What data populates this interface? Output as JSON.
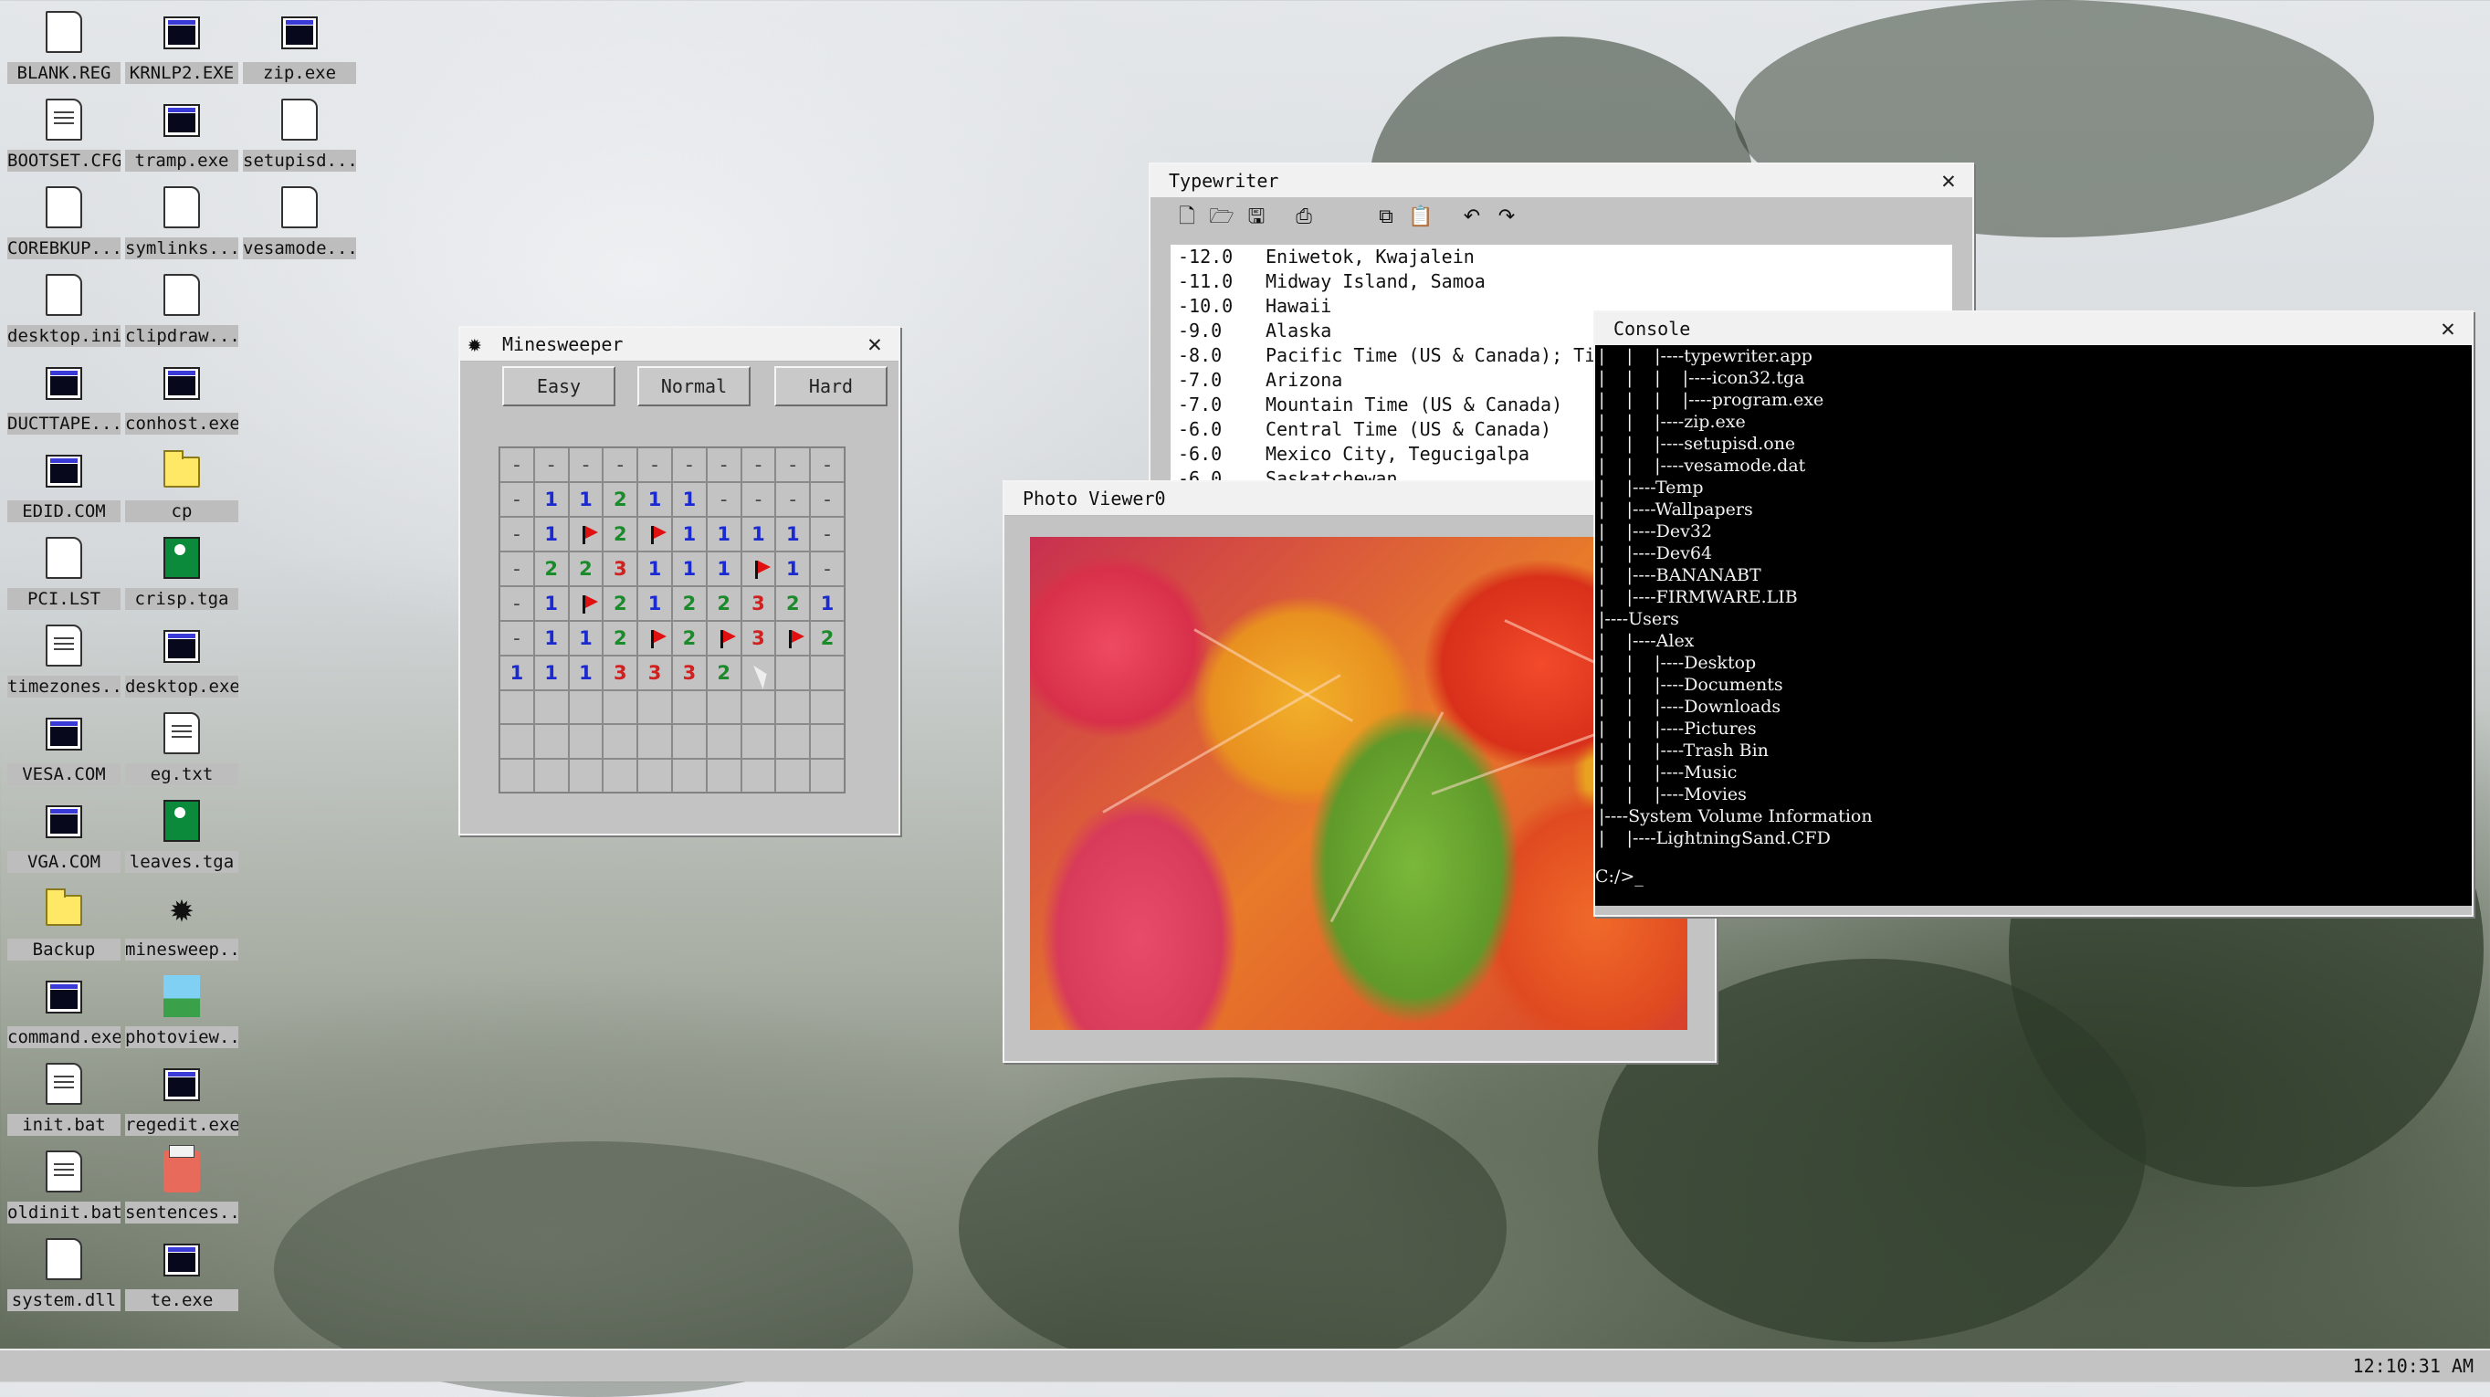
{
  "desktop": {
    "icons": [
      {
        "label": "BLANK.REG",
        "icon": "document-icon"
      },
      {
        "label": "KRNLP2.EXE",
        "icon": "program-icon"
      },
      {
        "label": "zip.exe",
        "icon": "program-icon"
      },
      {
        "label": "BOOTSET.CFG",
        "icon": "config-icon"
      },
      {
        "label": "tramp.exe",
        "icon": "program-icon"
      },
      {
        "label": "setupisd...",
        "icon": "document-icon"
      },
      {
        "label": "COREBKUP...",
        "icon": "document-icon"
      },
      {
        "label": "symlinks...",
        "icon": "document-icon"
      },
      {
        "label": "vesamode...",
        "icon": "document-icon"
      },
      {
        "label": "desktop.ini",
        "icon": "document-icon"
      },
      {
        "label": "clipdraw...",
        "icon": "document-icon"
      },
      {
        "label": "DUCTTAPE...",
        "icon": "program-icon"
      },
      {
        "label": "conhost.exe",
        "icon": "program-icon"
      },
      {
        "label": "EDID.COM",
        "icon": "program-icon"
      },
      {
        "label": "cp",
        "icon": "folder-icon"
      },
      {
        "label": "PCI.LST",
        "icon": "document-icon"
      },
      {
        "label": "crisp.tga",
        "icon": "image-icon"
      },
      {
        "label": "timezones...",
        "icon": "text-file-icon"
      },
      {
        "label": "desktop.exe",
        "icon": "program-icon"
      },
      {
        "label": "VESA.COM",
        "icon": "program-icon"
      },
      {
        "label": "eg.txt",
        "icon": "text-file-icon"
      },
      {
        "label": "VGA.COM",
        "icon": "program-icon"
      },
      {
        "label": "leaves.tga",
        "icon": "image-icon"
      },
      {
        "label": "Backup",
        "icon": "folder-icon"
      },
      {
        "label": "minesweep...",
        "icon": "mine-icon"
      },
      {
        "label": "command.exe",
        "icon": "program-icon"
      },
      {
        "label": "photoview...",
        "icon": "photo-viewer-icon"
      },
      {
        "label": "init.bat",
        "icon": "batch-file-icon"
      },
      {
        "label": "regedit.exe",
        "icon": "program-icon"
      },
      {
        "label": "oldinit.bat",
        "icon": "batch-file-icon"
      },
      {
        "label": "sentences...",
        "icon": "typewriter-icon"
      },
      {
        "label": "system.dll",
        "icon": "document-icon"
      },
      {
        "label": "te.exe",
        "icon": "program-icon"
      }
    ]
  },
  "minesweeper": {
    "title": "Minesweeper",
    "buttons": {
      "easy": "Easy",
      "normal": "Normal",
      "hard": "Hard"
    },
    "grid": [
      [
        "-",
        "-",
        "-",
        "-",
        "-",
        "-",
        "-",
        "-",
        "-",
        "-"
      ],
      [
        "-",
        "1",
        "1",
        "2",
        "1",
        "1",
        "-",
        "-",
        "-",
        "-"
      ],
      [
        "-",
        "1",
        "F",
        "2",
        "F",
        "1",
        "1",
        "1",
        "1",
        "-"
      ],
      [
        "-",
        "2",
        "2",
        "3",
        "1",
        "1",
        "1",
        "F",
        "1",
        "-"
      ],
      [
        "-",
        "1",
        "F",
        "2",
        "1",
        "2",
        "2",
        "3",
        "2",
        "1"
      ],
      [
        "-",
        "1",
        "1",
        "2",
        "F",
        "2",
        "F",
        "3",
        "F",
        "2"
      ],
      [
        "1",
        "1",
        "1",
        "3",
        "3",
        "3",
        "2",
        "",
        "",
        ""
      ],
      [
        "",
        "",
        "",
        "",
        "",
        "",
        "",
        "",
        "",
        ""
      ],
      [
        "",
        "",
        "",
        "",
        "",
        "",
        "",
        "",
        "",
        ""
      ],
      [
        "",
        "",
        "",
        "",
        "",
        "",
        "",
        "",
        "",
        ""
      ]
    ]
  },
  "typewriter": {
    "title": "Typewriter",
    "toolbar": [
      "new-file-icon",
      "open-folder-icon",
      "save-icon",
      "print-icon",
      "copy-icon",
      "paste-icon",
      "undo-icon",
      "redo-icon"
    ],
    "lines": [
      {
        "offset": "-12.0",
        "zone": "Eniwetok, Kwajalein"
      },
      {
        "offset": "-11.0",
        "zone": "Midway Island, Samoa"
      },
      {
        "offset": "-10.0",
        "zone": "Hawaii"
      },
      {
        "offset": "-9.0",
        "zone": "Alaska"
      },
      {
        "offset": "-8.0",
        "zone": "Pacific Time (US & Canada); Tiju"
      },
      {
        "offset": "-7.0",
        "zone": "Arizona"
      },
      {
        "offset": "-7.0",
        "zone": "Mountain Time (US & Canada)"
      },
      {
        "offset": "-6.0",
        "zone": "Central Time (US & Canada)"
      },
      {
        "offset": "-6.0",
        "zone": "Mexico City, Tegucigalpa"
      },
      {
        "offset": "-6.0",
        "zone": "Saskatchewan"
      }
    ]
  },
  "photo_viewer": {
    "title": "Photo Viewer0"
  },
  "console": {
    "title": "Console",
    "lines": [
      "|    |    |----typewriter.app",
      "|    |    |    |----icon32.tga",
      "|    |    |    |----program.exe",
      "|    |    |----zip.exe",
      "|    |    |----setupisd.one",
      "|    |    |----vesamode.dat",
      "|    |----Temp",
      "|    |----Wallpapers",
      "|    |----Dev32",
      "|    |----Dev64",
      "|    |----BANANABT",
      "|    |----FIRMWARE.LIB",
      "|----Users",
      "|    |----Alex",
      "|    |    |----Desktop",
      "|    |    |----Documents",
      "|    |    |----Downloads",
      "|    |    |----Pictures",
      "|    |    |----Trash Bin",
      "|    |    |----Music",
      "|    |    |----Movies",
      "|----System Volume Information",
      "|    |----LightningSand.CFD"
    ],
    "prompt": "C:/>_"
  },
  "taskbar": {
    "clock": "12:10:31 AM"
  }
}
